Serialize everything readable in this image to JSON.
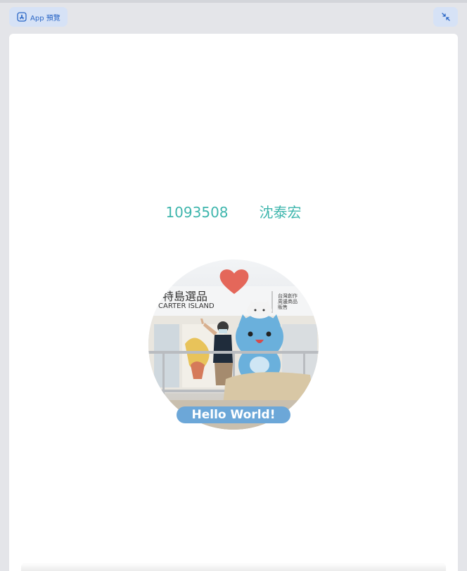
{
  "toolbar": {
    "app_preview_label": "App 預覽"
  },
  "profile": {
    "student_id": "1093508",
    "name": "沈泰宏",
    "caption": "Hello World!",
    "sign_lines": [
      "卡特島選品",
      "CARTER ISLAND"
    ],
    "side_sign_lines": [
      "台灣創作",
      "周邊商品",
      "販售"
    ]
  },
  "colors": {
    "accent_text": "#3fb6ad",
    "button_bg": "#d6e2f6",
    "button_fg": "#2b67c6",
    "caption_bg": "#6ca7d8",
    "heart": "#e4675a"
  }
}
